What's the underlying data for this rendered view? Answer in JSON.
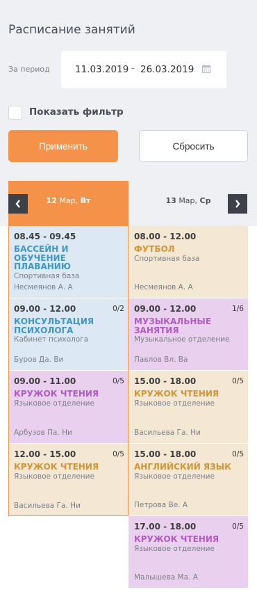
{
  "header": {
    "title": "Расписание занятий",
    "period_label": "За период",
    "date_from": "11.03.2019",
    "date_separator": "-",
    "date_to": "26.03.2019",
    "filter_label": "Показать фильтр",
    "filter_checked": false,
    "apply_label": "Применить",
    "reset_label": "Сбросить"
  },
  "days": {
    "active": {
      "day": "12",
      "month": "Мар,",
      "weekday": "Вт"
    },
    "next": {
      "day": "13",
      "month": "Мар,",
      "weekday": "Ср"
    }
  },
  "colors": {
    "accent": "#f5924a",
    "blue_card": "#dce9f5",
    "purple_card": "#e9d0ee",
    "beige_card": "#f4e7d4"
  },
  "schedule": {
    "col1": [
      {
        "time": "08.45 - 09.45",
        "count": "",
        "subject": "Бассейн и обучение плаванию",
        "place": "Спортивная база",
        "teacher": "Несмеянов А. А",
        "color": "blue"
      },
      {
        "time": "09.00 - 12.00",
        "count": "0/2",
        "subject": "Консультация психолога",
        "place": "Кабинет психолога",
        "teacher": "Буров Да. Ви",
        "color": "blue"
      },
      {
        "time": "09.00 - 11.00",
        "count": "0/5",
        "subject": "Кружок чтения",
        "place": "Языковое отделение",
        "teacher": "Арбузов Па. Ни",
        "color": "purple"
      },
      {
        "time": "12.00 - 15.00",
        "count": "0/5",
        "subject": "Кружок чтения",
        "place": "Языковое отделение",
        "teacher": "Васильева Га. Ни",
        "color": "beige"
      }
    ],
    "col2": [
      {
        "time": "08.00 - 12.00",
        "count": "",
        "subject": "Футбол",
        "place": "Спортивная база",
        "teacher": "Несмеянов А. А",
        "color": "beige"
      },
      {
        "time": "09.00 - 12.00",
        "count": "1/6",
        "subject": "Музыкальные занятия",
        "place": "Музыкальное отделение",
        "teacher": "Павлов Вл. Ва",
        "color": "purple"
      },
      {
        "time": "15.00 - 18.00",
        "count": "0/5",
        "subject": "Кружок чтения",
        "place": "Языковое отделение",
        "teacher": "Васильева Га. Ни",
        "color": "beige"
      },
      {
        "time": "15.00 - 18.00",
        "count": "0/5",
        "subject": "Английский язык",
        "place": "Языковое отделение",
        "teacher": "Петрова Ве. А",
        "color": "beige"
      },
      {
        "time": "17.00 - 18.00",
        "count": "0/5",
        "subject": "Кружок чтения",
        "place": "Языковое отделение",
        "teacher": "Малышева Ма. А",
        "color": "purple"
      }
    ]
  }
}
